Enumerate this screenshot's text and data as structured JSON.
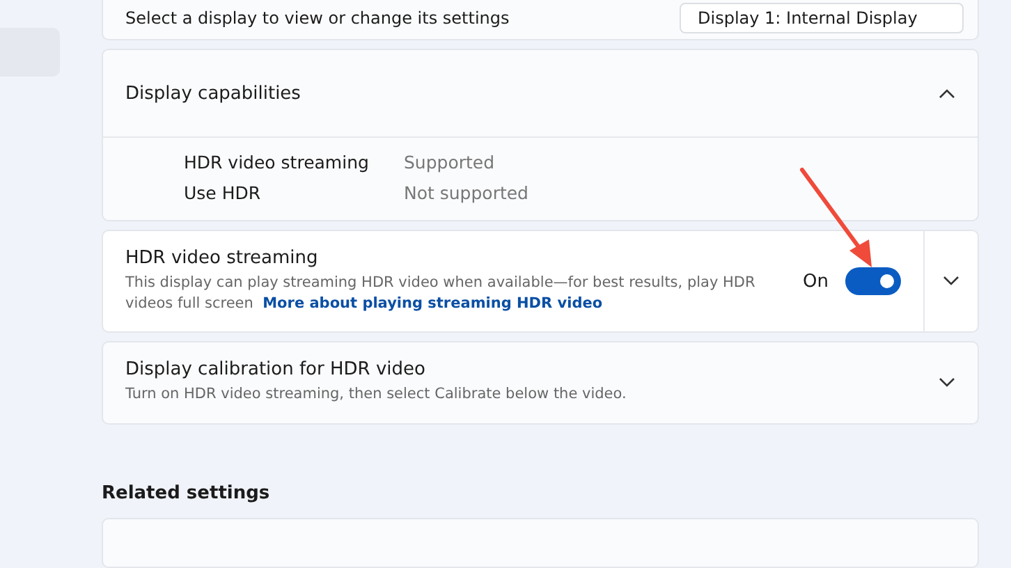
{
  "display_select": {
    "label": "Select a display to view or change its settings",
    "value": "Display 1: Internal Display"
  },
  "capabilities": {
    "title": "Display capabilities",
    "expanded": true,
    "rows": [
      {
        "name": "HDR video streaming",
        "value": "Supported"
      },
      {
        "name": "Use HDR",
        "value": "Not supported"
      }
    ]
  },
  "hdr_streaming": {
    "title": "HDR video streaming",
    "description": "This display can play streaming HDR video when available—for best results, play HDR videos full screen",
    "link": "More about playing streaming HDR video",
    "state_label": "On",
    "on": true,
    "expanded": false
  },
  "calibration": {
    "title": "Display calibration for HDR video",
    "description": "Turn on HDR video streaming, then select Calibrate below the video.",
    "expanded": false
  },
  "related": {
    "title": "Related settings"
  }
}
